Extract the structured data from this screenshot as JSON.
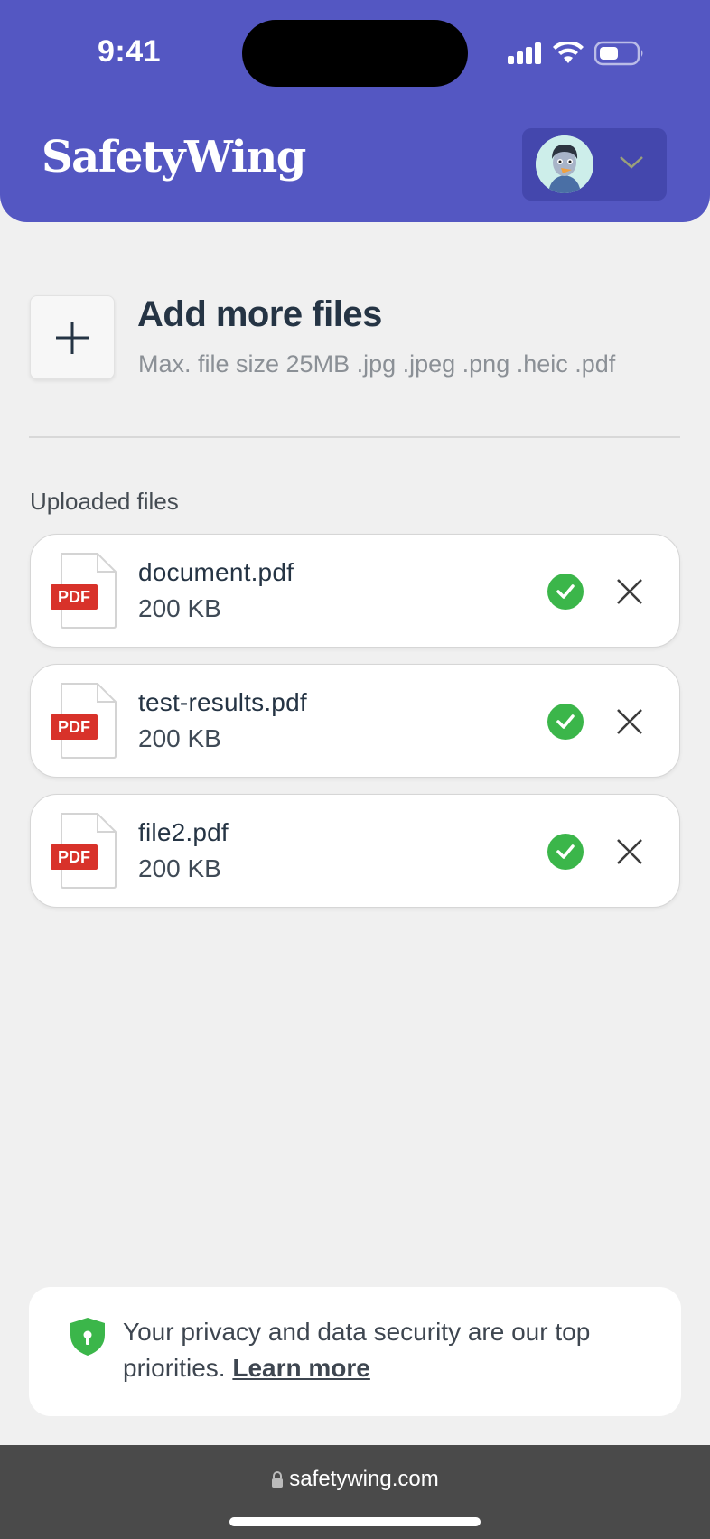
{
  "status_bar": {
    "time": "9:41"
  },
  "header": {
    "logo": "SafetyWing",
    "brand_color": "#5457c2",
    "avatar_icon": "user-avatar",
    "menu_icon": "chevron-down-icon"
  },
  "upload": {
    "title": "Add more files",
    "hint": "Max. file size 25MB .jpg .jpeg .png .heic .pdf",
    "add_icon": "plus-icon"
  },
  "uploaded": {
    "heading": "Uploaded files",
    "files": [
      {
        "name": "document.pdf",
        "size": "200 KB",
        "type_label": "PDF",
        "status": "uploaded"
      },
      {
        "name": "test-results.pdf",
        "size": "200 KB",
        "type_label": "PDF",
        "status": "uploaded"
      },
      {
        "name": "file2.pdf",
        "size": "200 KB",
        "type_label": "PDF",
        "status": "uploaded"
      }
    ],
    "success_color": "#3bb64a",
    "pdf_badge_color": "#d8322a"
  },
  "privacy": {
    "text": "Your privacy and data security are our top priorities.",
    "link": "Learn more",
    "shield_color": "#3bb64a"
  },
  "browser": {
    "url": "safetywing.com"
  }
}
